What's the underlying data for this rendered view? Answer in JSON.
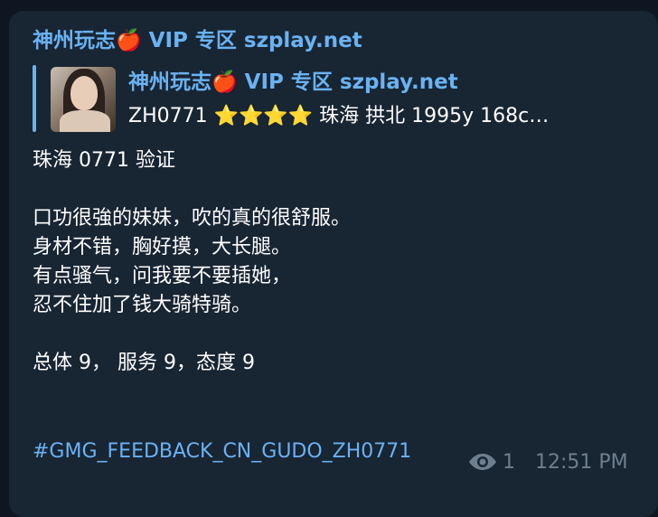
{
  "message": {
    "sender": "神州玩志🍎 VIP 专区 szplay.net",
    "reply": {
      "title": "神州玩志🍎 VIP 专区 szplay.net",
      "text": "ZH0771 ⭐⭐⭐⭐ 珠海 拱北 1995y  168c…",
      "thumbnail": "woman-photo"
    },
    "body_lines": [
      "珠海 0771 验证",
      "",
      "口功很強的妹妹，吹的真的很舒服。",
      "身材不错，胸好摸，大长腿。",
      "有点骚气，问我要不要插她，",
      "忍不住加了钱大骑特骑。",
      "",
      "总体  9， 服务 9，态度 9"
    ],
    "hashtag": "#GMG_FEEDBACK_CN_GUDO_ZH0771",
    "views": "1",
    "time": "12:51 PM"
  },
  "colors": {
    "background": "#0e1621",
    "bubble": "#182533",
    "accent": "#6ab2f2",
    "text": "#ffffff",
    "meta": "#6d7f8f"
  },
  "icons": {
    "views": "eye-icon"
  }
}
